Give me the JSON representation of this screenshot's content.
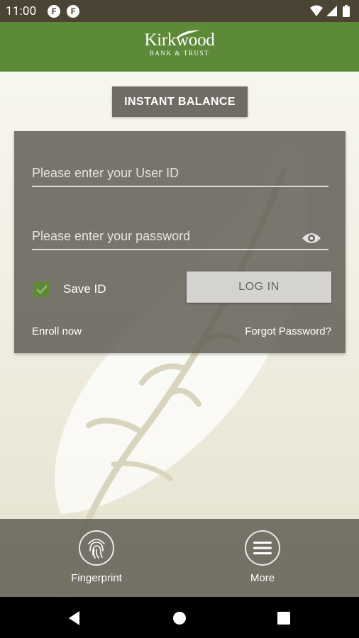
{
  "status_bar": {
    "time": "11:00",
    "notification_icons": [
      "F",
      "F"
    ],
    "right_icons": [
      "wifi-icon",
      "cell-signal-icon",
      "battery-icon"
    ]
  },
  "header": {
    "logo_name": "Kirkwood",
    "logo_subtitle": "BANK & TRUST"
  },
  "instant_balance": {
    "label": "INSTANT BALANCE"
  },
  "login": {
    "user_id_placeholder": "Please enter your User ID",
    "user_id_value": "",
    "password_placeholder": "Please enter your password",
    "password_value": "",
    "save_id_label": "Save ID",
    "save_id_checked": true,
    "login_label": "LOG IN",
    "enroll_label": "Enroll now",
    "forgot_label": "Forgot Password?"
  },
  "bottom_nav": {
    "items": [
      {
        "label": "Fingerprint",
        "icon": "fingerprint-icon"
      },
      {
        "label": "More",
        "icon": "hamburger-menu-icon"
      }
    ]
  },
  "system_nav": {
    "buttons": [
      "back-icon",
      "home-icon",
      "recents-icon"
    ]
  },
  "colors": {
    "brand_green": "#5d8a38",
    "status_bar": "#4b4333",
    "card_gray": "#646258",
    "button_gray": "#6e6c63"
  }
}
